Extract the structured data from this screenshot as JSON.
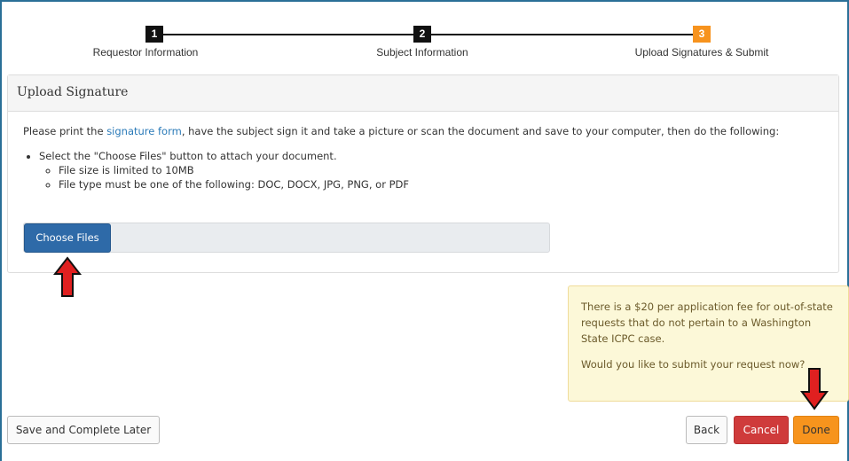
{
  "stepper": {
    "steps": [
      {
        "number": "1",
        "label": "Requestor Information"
      },
      {
        "number": "2",
        "label": "Subject Information"
      },
      {
        "number": "3",
        "label": "Upload Signatures & Submit"
      }
    ],
    "active_color": "#f7931e"
  },
  "panel": {
    "title": "Upload Signature",
    "intro_before": "Please print the ",
    "intro_link": "signature form",
    "intro_after": ", have the subject sign it and take a picture or scan the document and save to your computer, then do the following:",
    "bullet": "Select the \"Choose Files\" button to attach your document.",
    "sub_bullets": [
      "File size is limited to 10MB",
      "File type must be one of the following: DOC, DOCX, JPG, PNG, or PDF"
    ],
    "choose_files_label": "Choose Files"
  },
  "notice": {
    "fee_text": "There is a $20 per application fee for out-of-state requests that do not pertain to a Washington State ICPC case.",
    "question": "Would you like to submit your request now?"
  },
  "buttons": {
    "save_later": "Save and Complete Later",
    "back": "Back",
    "cancel": "Cancel",
    "done": "Done"
  },
  "annotations": {
    "arrow_color": "#e02020"
  }
}
